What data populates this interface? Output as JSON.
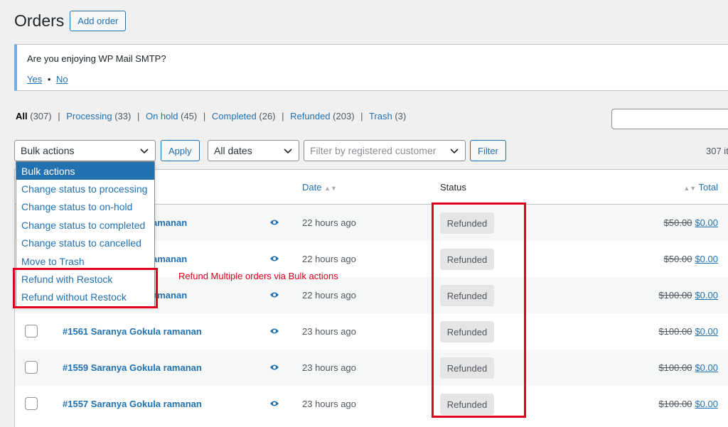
{
  "header": {
    "title": "Orders",
    "add_order_label": "Add order"
  },
  "notice": {
    "text": "Are you enjoying WP Mail SMTP?",
    "yes_label": "Yes",
    "separator": "•",
    "no_label": "No"
  },
  "filters": {
    "views": [
      {
        "label": "All",
        "count": "(307)"
      },
      {
        "label": "Processing",
        "count": "(33)"
      },
      {
        "label": "On hold",
        "count": "(45)"
      },
      {
        "label": "Completed",
        "count": "(26)"
      },
      {
        "label": "Refunded",
        "count": "(203)"
      },
      {
        "label": "Trash",
        "count": "(3)"
      }
    ],
    "separator": "|"
  },
  "tablenav": {
    "bulk_actions_value": "Bulk actions",
    "apply_label": "Apply",
    "dates_value": "All dates",
    "customer_placeholder": "Filter by registered customer",
    "filter_label": "Filter",
    "items_count": "307 it"
  },
  "bulk_dropdown": {
    "options": [
      "Bulk actions",
      "Change status to processing",
      "Change status to on-hold",
      "Change status to completed",
      "Change status to cancelled",
      "Move to Trash",
      "Refund with Restock",
      "Refund without Restock"
    ]
  },
  "table": {
    "columns": {
      "date": "Date",
      "status": "Status",
      "total": "Total"
    },
    "rows": [
      {
        "order": "amanan",
        "date": "22 hours ago",
        "status": "Refunded",
        "old_total": "$50.00",
        "new_total": "$0.00"
      },
      {
        "order": "amanan",
        "date": "22 hours ago",
        "status": "Refunded",
        "old_total": "$50.00",
        "new_total": "$0.00"
      },
      {
        "order": "amanan",
        "date": "22 hours ago",
        "status": "Refunded",
        "old_total": "$100.00",
        "new_total": "$0.00"
      },
      {
        "order": "#1561 Saranya Gokula ramanan",
        "date": "23 hours ago",
        "status": "Refunded",
        "old_total": "$100.00",
        "new_total": "$0.00"
      },
      {
        "order": "#1559 Saranya Gokula ramanan",
        "date": "23 hours ago",
        "status": "Refunded",
        "old_total": "$100.00",
        "new_total": "$0.00"
      },
      {
        "order": "#1557 Saranya Gokula ramanan",
        "date": "23 hours ago",
        "status": "Refunded",
        "old_total": "$100.00",
        "new_total": "$0.00"
      }
    ]
  },
  "annotation": {
    "text": "Refund Multiple orders via Bulk actions",
    "color": "#e0001b"
  },
  "colors": {
    "link": "#2271b1",
    "selected_bg": "#2271b1",
    "highlight": "#e0001b"
  }
}
